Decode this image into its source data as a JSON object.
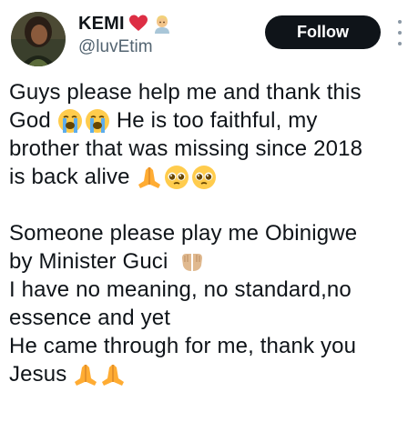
{
  "author": {
    "display_name": "KEMI",
    "handle": "@luvEtim",
    "name_emojis": [
      "red-heart-icon",
      "person-blond-icon"
    ]
  },
  "actions": {
    "follow_label": "Follow",
    "more_icon": "more-options-icon"
  },
  "tweet": {
    "line1": "Guys please help me and thank this",
    "line2_a": "God",
    "line2_b": "He is too faithful, my",
    "line3": "brother that was missing since 2018",
    "line4": "is back alive",
    "line5": "Someone please play me Obinigwe",
    "line6": "by Minister Guci",
    "line7": "I have no meaning, no standard,no",
    "line8": "essence and yet",
    "line9": "He came through for me, thank you",
    "line10": "Jesus",
    "emojis": [
      "loudly-crying-face-icon",
      "folded-hands-icon",
      "pleading-face-icon",
      "palms-up-together-icon"
    ]
  },
  "colors": {
    "text": "#0f1419",
    "secondary": "#536471",
    "button_bg": "#0f1419",
    "button_text": "#ffffff"
  }
}
